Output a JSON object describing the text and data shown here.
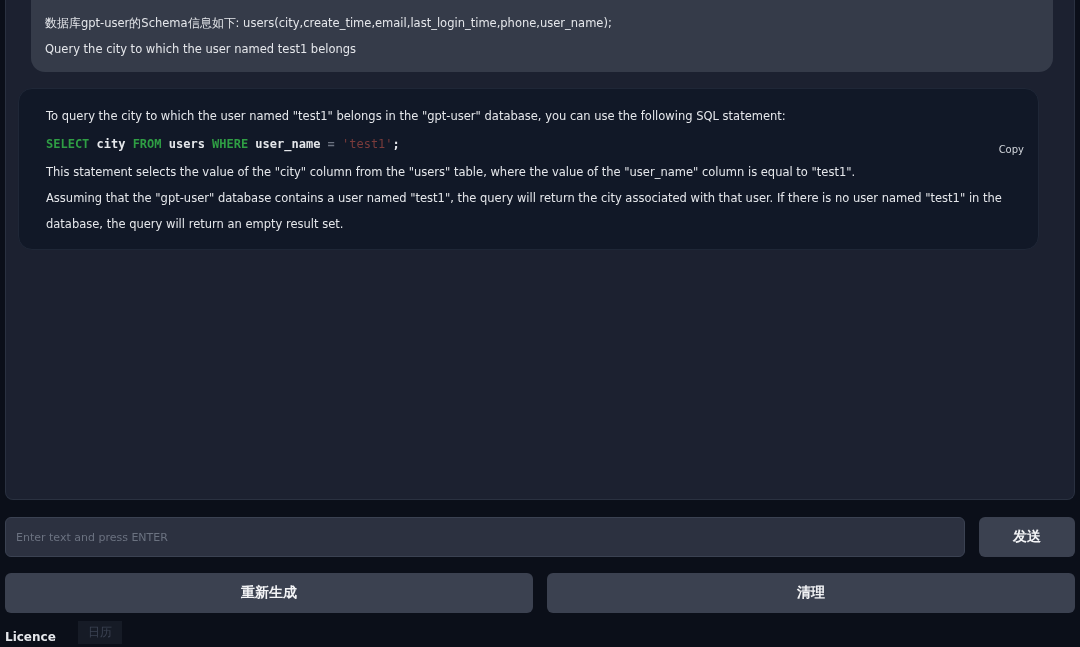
{
  "chat": {
    "messages": [
      {
        "kind": "user",
        "lines": [
          "数据库gpt-user的Schema信息如下: users(city,create_time,email,last_login_time,phone,user_name);",
          "Query the city to which the user named test1 belongs"
        ]
      },
      {
        "kind": "bot",
        "intro": "To query the city to which the user named \"test1\" belongs in the \"gpt-user\" database, you can use the following SQL statement:",
        "code": [
          {
            "kind": "keyword",
            "text": "SELECT"
          },
          {
            "kind": "plain",
            "text": "city"
          },
          {
            "kind": "keyword",
            "text": "FROM"
          },
          {
            "kind": "plain",
            "text": "users"
          },
          {
            "kind": "keyword",
            "text": "WHERE"
          },
          {
            "kind": "plain",
            "text": "user_name"
          },
          {
            "kind": "operator",
            "text": "="
          },
          {
            "kind": "string",
            "text": "'test1'"
          },
          {
            "kind": "plain",
            "text": ";"
          }
        ],
        "copy_label": "Copy",
        "outro": [
          "This statement selects the value of the \"city\" column from the \"users\" table, where the value of the \"user_name\" column is equal to \"test1\".",
          "Assuming that the \"gpt-user\" database contains a user named \"test1\", the query will return the city associated with that user. If there is no user named \"test1\" in the database, the query will return an empty result set."
        ]
      }
    ]
  },
  "input": {
    "placeholder": "Enter text and press ENTER"
  },
  "send_button": "发送",
  "buttons": [
    "重新生成",
    "清理"
  ],
  "footer": {
    "licence": "Licence",
    "faint_button": "日历"
  }
}
